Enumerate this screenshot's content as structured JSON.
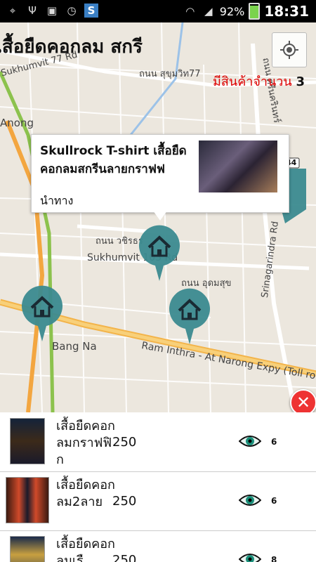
{
  "status": {
    "battery": "92%",
    "time": "18:31",
    "icons": [
      "gps-icon",
      "usb-icon",
      "gallery-icon",
      "clock-icon",
      "app-s-icon",
      "wifi-icon",
      "signal-icon",
      "battery-icon"
    ]
  },
  "header": {
    "title": "เสื้อยืดคอกลม สกรี"
  },
  "count": {
    "label": "มีสินค้าจำนวน",
    "value": "3"
  },
  "map_labels": {
    "sukhumvit77": "Sukhumvit 77 Rd",
    "sukhumvit77_th": "ถนน สุขุมวิท77",
    "anong": "Anong",
    "wachira": "ถนน วชิรธร",
    "sukhumvit103": "Sukhumvit 103 Rd",
    "udomsuk": "ถนน อุดมสุข",
    "bangna": "Bang Na",
    "ramintra": "Ram Inthra - At Narong Expy (Toll ro",
    "srinagarindra": "Srinagarindra Rd",
    "route44": "44",
    "srinakarin_th": "ถนน ศรีนครินทร์"
  },
  "popup": {
    "title": "Skullrock T-shirt เสื้อยืดคอกลมสกรีนลายกราฟฟ",
    "nav": "นำทาง"
  },
  "items": [
    {
      "name": "เสื้อยืดคอกลมกราฟฟิก",
      "price": "250",
      "views": "6"
    },
    {
      "name": "เสื้อยืดคอกลม2ลาย",
      "price": "250",
      "views": "6"
    },
    {
      "name": "เสื้อยืดคอกลมเรื",
      "price": "250",
      "views": "8"
    }
  ],
  "colors": {
    "pin": "#3b8a8f",
    "close": "#e33333",
    "count_label": "#dd0000"
  }
}
